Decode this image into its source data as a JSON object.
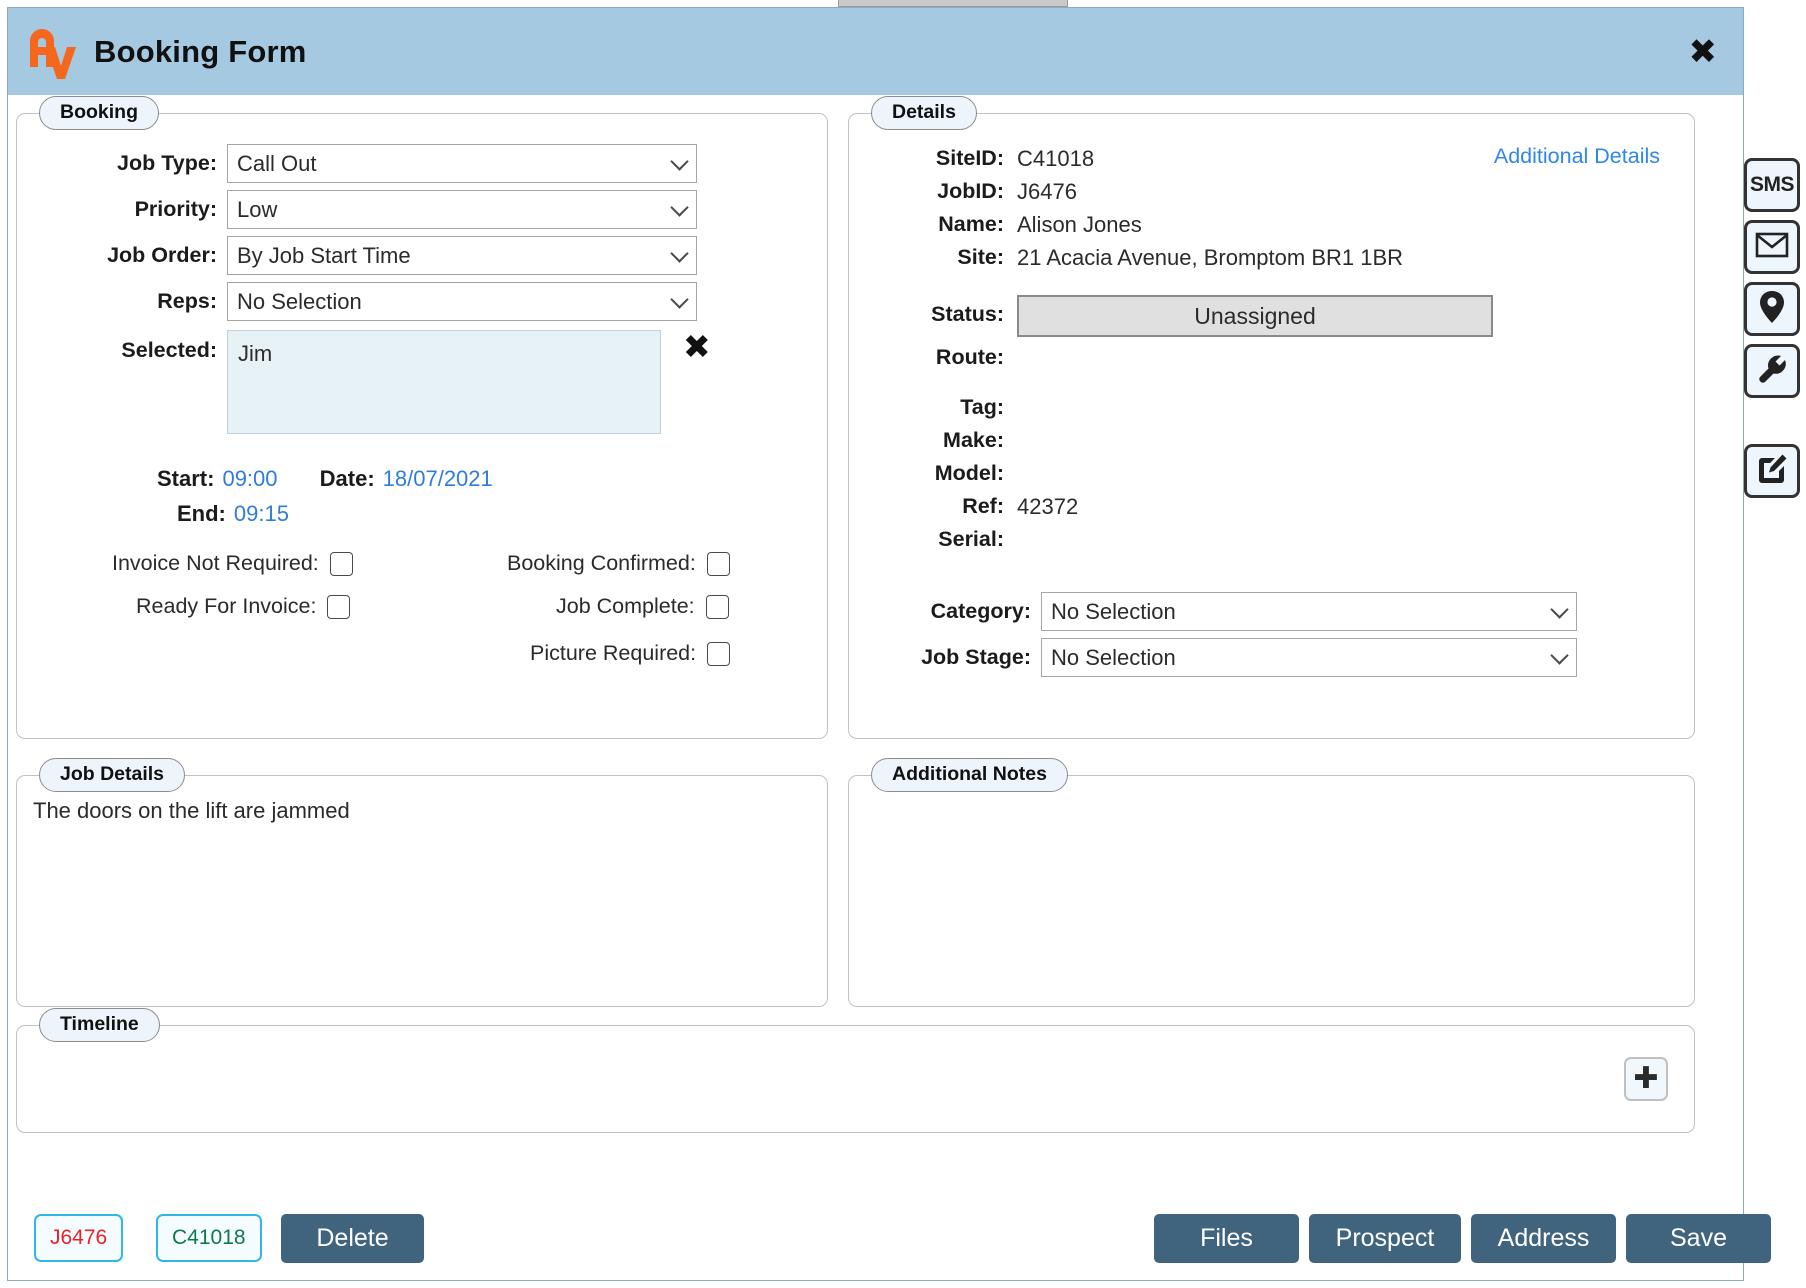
{
  "window": {
    "title": "Booking Form",
    "close_label": "✖",
    "logo_name": "av-logo"
  },
  "booking": {
    "legend": "Booking",
    "fields": [
      {
        "label": "Job Type:",
        "value": "Call Out"
      },
      {
        "label": "Priority:",
        "value": "Low"
      },
      {
        "label": "Job Order:",
        "value": "By Job Start Time"
      },
      {
        "label": "Reps:",
        "value": "No Selection"
      }
    ],
    "selected": {
      "label": "Selected:",
      "value": "Jim",
      "clear_label": "✖"
    },
    "times": {
      "start_label": "Start:",
      "start_value": "09:00",
      "date_label": "Date:",
      "date_value": "18/07/2021",
      "end_label": "End:",
      "end_value": "09:15"
    },
    "checkboxes_left": [
      {
        "label": "Invoice Not Required:",
        "checked": false
      },
      {
        "label": "Ready For Invoice:",
        "checked": false
      }
    ],
    "checkboxes_right": [
      {
        "label": "Booking Confirmed:",
        "checked": false
      },
      {
        "label": "Job Complete:",
        "checked": false
      },
      {
        "label": "Picture Required:",
        "checked": false
      }
    ]
  },
  "details": {
    "legend": "Details",
    "additional_details_link": "Additional Details",
    "rows": [
      {
        "label": "SiteID:",
        "value": "C41018"
      },
      {
        "label": "JobID:",
        "value": "J6476"
      },
      {
        "label": "Name:",
        "value": "Alison Jones"
      },
      {
        "label": "Site:",
        "value": "21 Acacia Avenue, Bromptom BR1 1BR"
      }
    ],
    "status": {
      "label": "Status:",
      "value": "Unassigned"
    },
    "rows2": [
      {
        "label": "Route:",
        "value": ""
      },
      {
        "label": "Tag:",
        "value": ""
      },
      {
        "label": "Make:",
        "value": ""
      },
      {
        "label": "Model:",
        "value": ""
      },
      {
        "label": "Ref:",
        "value": "42372"
      },
      {
        "label": "Serial:",
        "value": ""
      }
    ],
    "selects": [
      {
        "label": "Category:",
        "value": "No Selection"
      },
      {
        "label": "Job Stage:",
        "value": "No Selection"
      }
    ]
  },
  "job_details": {
    "legend": "Job Details",
    "text": "The doors on the lift are jammed"
  },
  "additional_notes": {
    "legend": "Additional Notes",
    "text": ""
  },
  "timeline": {
    "legend": "Timeline",
    "add_label": "✚"
  },
  "footer": {
    "job_badge": "J6476",
    "site_badge": "C41018",
    "delete_label": "Delete",
    "files_label": "Files",
    "prospect_label": "Prospect",
    "address_label": "Address",
    "save_label": "Save"
  },
  "rail": {
    "sms_label": "SMS",
    "items": [
      "sms",
      "email",
      "location",
      "tools",
      "edit"
    ]
  },
  "colors": {
    "titlebar": "#a6c9e2",
    "accent_blue": "#2f86ef",
    "button": "#41647e",
    "logo_orange": "#f4671c",
    "badge_job": "#e8242b",
    "badge_site": "#0f7a47",
    "badge_border": "#2fb7e8"
  }
}
